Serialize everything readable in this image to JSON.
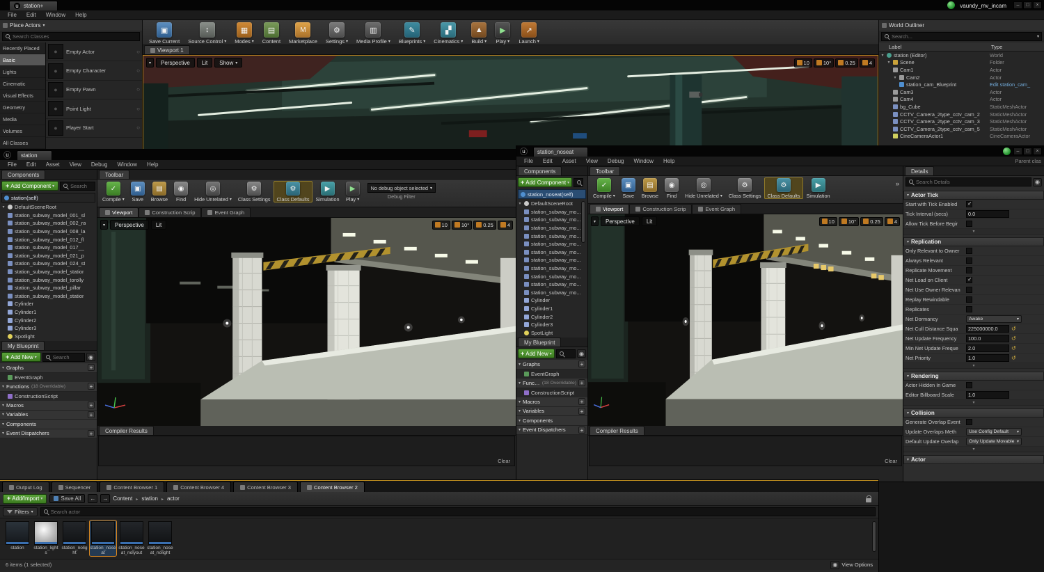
{
  "main": {
    "tab": "station+",
    "menus": [
      "File",
      "Edit",
      "Window",
      "Help"
    ],
    "session_label": "vaundy_mv_incam",
    "toolbar": [
      {
        "label": "Save Current",
        "icon": "save-icon"
      },
      {
        "label": "Source Control",
        "icon": "source-control-icon",
        "dropdown": "1"
      },
      {
        "label": "Modes",
        "icon": "modes-icon",
        "dropdown": "1"
      },
      {
        "label": "Content",
        "icon": "content-icon"
      },
      {
        "label": "Marketplace",
        "icon": "marketplace-icon"
      },
      {
        "label": "Settings",
        "icon": "settings-icon",
        "dropdown": "1"
      },
      {
        "label": "Media Profile",
        "icon": "media-profile-icon",
        "dropdown": "1"
      },
      {
        "label": "Blueprints",
        "icon": "blueprints-icon",
        "dropdown": "1"
      },
      {
        "label": "Cinematics",
        "icon": "cinematics-icon",
        "dropdown": "1"
      },
      {
        "label": "Build",
        "icon": "build-icon",
        "dropdown": "1"
      },
      {
        "label": "Play",
        "icon": "play-icon",
        "dropdown": "1"
      },
      {
        "label": "Launch",
        "icon": "launch-icon",
        "dropdown": "1"
      }
    ],
    "place_actors": {
      "title": "Place Actors",
      "search_placeholder": "Search Classes",
      "categories": [
        {
          "label": "Recently Placed"
        },
        {
          "label": "Basic",
          "state": "active"
        },
        {
          "label": "Lights"
        },
        {
          "label": "Cinematic"
        },
        {
          "label": "Visual Effects"
        },
        {
          "label": "Geometry"
        },
        {
          "label": "Media"
        },
        {
          "label": "Volumes"
        },
        {
          "label": "All Classes"
        }
      ],
      "items": [
        {
          "label": "Empty Actor"
        },
        {
          "label": "Empty Character"
        },
        {
          "label": "Empty Pawn"
        },
        {
          "label": "Point Light"
        },
        {
          "label": "Player Start"
        }
      ]
    },
    "viewport": {
      "tab": "Viewport 1",
      "persp": "Perspective",
      "lit": "Lit",
      "show": "Show",
      "stats": [
        "10",
        "10°",
        "0.25",
        "4"
      ]
    },
    "outliner": {
      "title": "World Outliner",
      "search_placeholder": "Search...",
      "col_label": "Label",
      "col_type": "Type",
      "rows": [
        {
          "label": "station (Editor)",
          "type": "World",
          "indent": 0,
          "icon": "world-icon",
          "arrow": "1"
        },
        {
          "label": "Scene",
          "type": "Folder",
          "indent": 1,
          "icon": "folder-icon",
          "arrow": "1"
        },
        {
          "label": "Cam1",
          "type": "Actor",
          "indent": 2,
          "icon": "camera-icon"
        },
        {
          "label": "Cam2",
          "type": "Actor",
          "indent": 2,
          "icon": "camera-icon",
          "arrow": "1"
        },
        {
          "label": "station_cam_Blueprint",
          "type": "Edit station_cam_",
          "indent": 3,
          "icon": "blueprint-icon",
          "type_style": "link"
        },
        {
          "label": "Cam3",
          "type": "Actor",
          "indent": 2,
          "icon": "camera-icon"
        },
        {
          "label": "Cam4",
          "type": "Actor",
          "indent": 2,
          "icon": "camera-icon"
        },
        {
          "label": "bg_Cube",
          "type": "StaticMeshActor",
          "indent": 2,
          "icon": "mesh-icon"
        },
        {
          "label": "CCTV_Camera_2type_cctv_cam_2",
          "type": "StaticMeshActor",
          "indent": 2,
          "icon": "mesh-icon"
        },
        {
          "label": "CCTV_Camera_2type_cctv_cam_3",
          "type": "StaticMeshActor",
          "indent": 2,
          "icon": "mesh-icon"
        },
        {
          "label": "CCTV_Camera_2type_cctv_cam_5",
          "type": "StaticMeshActor",
          "indent": 2,
          "icon": "mesh-icon"
        },
        {
          "label": "CineCameraActor1",
          "type": "CineCameraActor",
          "indent": 2,
          "icon": "cinecam-icon"
        }
      ]
    }
  },
  "bp1": {
    "tab": "station",
    "menus": [
      "File",
      "Edit",
      "Asset",
      "View",
      "Debug",
      "Window",
      "Help"
    ],
    "components": {
      "tab": "Components",
      "add_label": "Add Component",
      "search_placeholder": "Search",
      "selector": "station(self)",
      "tree": [
        {
          "label": "DefaultSceneRoot",
          "indent": 0,
          "icon": "scene-icon",
          "arrow": "1"
        },
        {
          "label": "station_subway_model_001_sl",
          "indent": 1,
          "icon": "mesh-icon"
        },
        {
          "label": "station_subway_model_002_ra",
          "indent": 1,
          "icon": "mesh-icon"
        },
        {
          "label": "station_subway_model_008_la",
          "indent": 1,
          "icon": "mesh-icon"
        },
        {
          "label": "station_subway_model_012_fl",
          "indent": 1,
          "icon": "mesh-icon"
        },
        {
          "label": "station_subway_model_017__",
          "indent": 1,
          "icon": "mesh-icon"
        },
        {
          "label": "station_subway_model_021_p",
          "indent": 1,
          "icon": "mesh-icon"
        },
        {
          "label": "station_subway_model_024_st",
          "indent": 1,
          "icon": "mesh-icon"
        },
        {
          "label": "station_subway_model_statior",
          "indent": 1,
          "icon": "mesh-icon"
        },
        {
          "label": "station_subway_model_torolly",
          "indent": 1,
          "icon": "mesh-icon"
        },
        {
          "label": "station_subway_model_pillar",
          "indent": 1,
          "icon": "mesh-icon"
        },
        {
          "label": "station_subway_model_statior",
          "indent": 1,
          "icon": "mesh-icon"
        },
        {
          "label": "Cylinder",
          "indent": 1,
          "icon": "cylinder-icon"
        },
        {
          "label": "Cylinder1",
          "indent": 1,
          "icon": "cylinder-icon"
        },
        {
          "label": "Cylinder2",
          "indent": 1,
          "icon": "cylinder-icon"
        },
        {
          "label": "Cylinder3",
          "indent": 1,
          "icon": "cylinder-icon"
        },
        {
          "label": "Spotlight",
          "indent": 1,
          "icon": "light-icon"
        }
      ]
    },
    "my_blueprint": {
      "tab": "My Blueprint",
      "add_label": "Add New",
      "search_placeholder": "Search",
      "rows": [
        {
          "label": "Graphs",
          "kind": "header",
          "plus": "1"
        },
        {
          "label": "EventGraph",
          "kind": "child",
          "icon": "graphtab-icon",
          "indent": 1
        },
        {
          "label": "Functions",
          "note": "(18 Overridable)",
          "kind": "header",
          "plus": "1"
        },
        {
          "label": "ConstructionScript",
          "kind": "child",
          "icon": "function-icon",
          "indent": 1
        },
        {
          "label": "Macros",
          "kind": "header",
          "plus": "1"
        },
        {
          "label": "Variables",
          "kind": "header",
          "plus": "1"
        },
        {
          "label": "Components",
          "kind": "header"
        },
        {
          "label": "Event Dispatchers",
          "kind": "header",
          "plus": "1"
        }
      ]
    },
    "toolbar_tab": "Toolbar",
    "toolbar": [
      {
        "label": "Compile",
        "icon": "compile-icon",
        "dropdown": "1"
      },
      {
        "label": "Save",
        "icon": "save-icon"
      },
      {
        "label": "Browse",
        "icon": "browse-icon"
      },
      {
        "label": "Find",
        "icon": "find-icon"
      },
      {
        "label": "Hide Unrelated",
        "icon": "hide-unrelated-icon",
        "dropdown": "1"
      },
      {
        "label": "Class Settings",
        "icon": "class-settings-icon"
      },
      {
        "label": "Class Defaults",
        "icon": "class-defaults-icon",
        "state": "selected"
      },
      {
        "label": "Simulation",
        "icon": "simulation-icon"
      },
      {
        "label": "Play",
        "icon": "play-icon",
        "dropdown": "1"
      }
    ],
    "debug_value": "No debug object selected",
    "debug_caption": "Debug Filter",
    "tabs": [
      {
        "label": "Viewport",
        "icon": "viewport-icon",
        "state": "active"
      },
      {
        "label": "Construction Scrip",
        "icon": "script-icon"
      },
      {
        "label": "Event Graph",
        "icon": "graphtab-icon"
      }
    ],
    "viewport": {
      "persp": "Perspective",
      "lit": "Lit",
      "stats": [
        "10",
        "10°",
        "0.25",
        "4"
      ]
    },
    "compiler": {
      "tab": "Compiler Results",
      "clear": "Clear"
    }
  },
  "bp2": {
    "tab": "station_noseat",
    "menus": [
      "File",
      "Edit",
      "Asset",
      "View",
      "Debug",
      "Window",
      "Help"
    ],
    "parent_label": "Parent clas",
    "components": {
      "tab": "Components",
      "add_label": "Add Component",
      "search_placeholder": "Search",
      "selector": "station_noseat(self)",
      "tree": [
        {
          "label": "DefaultSceneRoot",
          "indent": 0,
          "icon": "scene-icon",
          "arrow": "1"
        },
        {
          "label": "station_subway_mo...",
          "indent": 1,
          "icon": "mesh-icon"
        },
        {
          "label": "station_subway_mo...",
          "indent": 1,
          "icon": "mesh-icon"
        },
        {
          "label": "station_subway_mo...",
          "indent": 1,
          "icon": "mesh-icon"
        },
        {
          "label": "station_subway_mo...",
          "indent": 1,
          "icon": "mesh-icon"
        },
        {
          "label": "station_subway_mo...",
          "indent": 1,
          "icon": "mesh-icon"
        },
        {
          "label": "station_subway_mo...",
          "indent": 1,
          "icon": "mesh-icon"
        },
        {
          "label": "station_subway_mo...",
          "indent": 1,
          "icon": "mesh-icon"
        },
        {
          "label": "station_subway_mo...",
          "indent": 1,
          "icon": "mesh-icon"
        },
        {
          "label": "station_subway_mo...",
          "indent": 1,
          "icon": "mesh-icon"
        },
        {
          "label": "station_subway_mo...",
          "indent": 1,
          "icon": "mesh-icon"
        },
        {
          "label": "station_subway_mo...",
          "indent": 1,
          "icon": "mesh-icon"
        },
        {
          "label": "Cylinder",
          "indent": 1,
          "icon": "cylinder-icon"
        },
        {
          "label": "Cylinder1",
          "indent": 1,
          "icon": "cylinder-icon"
        },
        {
          "label": "Cylinder2",
          "indent": 1,
          "icon": "cylinder-icon"
        },
        {
          "label": "Cylinder3",
          "indent": 1,
          "icon": "cylinder-icon"
        },
        {
          "label": "SpotLight",
          "indent": 1,
          "icon": "light-icon"
        }
      ]
    },
    "my_blueprint": {
      "tab": "My Blueprint",
      "add_label": "Add New",
      "search_placeholder": "Search",
      "rows": [
        {
          "label": "Graphs",
          "kind": "header",
          "plus": "1"
        },
        {
          "label": "EventGraph",
          "kind": "child",
          "icon": "graphtab-icon",
          "indent": 1
        },
        {
          "label": "Functions",
          "note": "(18 Overridable)",
          "kind": "header",
          "plus": "1"
        },
        {
          "label": "ConstructionScript",
          "kind": "child",
          "icon": "function-icon",
          "indent": 1
        },
        {
          "label": "Macros",
          "kind": "header",
          "plus": "1"
        },
        {
          "label": "Variables",
          "kind": "header",
          "plus": "1"
        },
        {
          "label": "Components",
          "kind": "header"
        },
        {
          "label": "Event Dispatchers",
          "kind": "header",
          "plus": "1"
        }
      ]
    },
    "toolbar_tab": "Toolbar",
    "toolbar": [
      {
        "label": "Compile",
        "icon": "compile-icon",
        "dropdown": "1"
      },
      {
        "label": "Save",
        "icon": "save-icon"
      },
      {
        "label": "Browse",
        "icon": "browse-icon"
      },
      {
        "label": "Find",
        "icon": "find-icon"
      },
      {
        "label": "Hide Unrelated",
        "icon": "hide-unrelated-icon",
        "dropdown": "1"
      },
      {
        "label": "Class Settings",
        "icon": "class-settings-icon"
      },
      {
        "label": "Class Defaults",
        "icon": "class-defaults-icon",
        "state": "selected"
      },
      {
        "label": "Simulation",
        "icon": "simulation-icon"
      }
    ],
    "tabs": [
      {
        "label": "Viewport",
        "icon": "viewport-icon",
        "state": "active"
      },
      {
        "label": "Construction Scrip",
        "icon": "script-icon"
      },
      {
        "label": "Event Graph",
        "icon": "graphtab-icon"
      }
    ],
    "viewport": {
      "persp": "Perspective",
      "lit": "Lit",
      "stats": [
        "10",
        "10°",
        "0.25",
        "4"
      ]
    },
    "compiler": {
      "tab": "Compiler Results",
      "clear": "Clear"
    }
  },
  "details": {
    "tab": "Details",
    "search_placeholder": "Search Details",
    "rows": [
      {
        "title": "Actor Tick"
      },
      {
        "label": "Start with Tick Enabled",
        "control": "checkbox",
        "state": "checked"
      },
      {
        "label": "Tick Interval (secs)",
        "control": "value",
        "value": "0.0"
      },
      {
        "label": "Allow Tick Before Begir",
        "control": "checkbox"
      },
      {
        "advanced": "1"
      },
      {
        "title": "Replication"
      },
      {
        "label": "Only Relevant to Owner",
        "control": "checkbox"
      },
      {
        "label": "Always Relevant",
        "control": "checkbox"
      },
      {
        "label": "Replicate Movement",
        "control": "checkbox"
      },
      {
        "label": "Net Load on Client",
        "control": "checkbox",
        "state": "checked"
      },
      {
        "label": "Net Use Owner Relevan",
        "control": "checkbox"
      },
      {
        "label": "Replay Rewindable",
        "control": "checkbox"
      },
      {
        "label": "Replicates",
        "control": "checkbox"
      },
      {
        "label": "Net Dormancy",
        "control": "dropdown",
        "value": "Awake"
      },
      {
        "label": "Net Cull Distance Squa",
        "control": "value",
        "value": "225000000.0",
        "reset": "show"
      },
      {
        "label": "Net Update Frequency",
        "control": "value",
        "value": "100.0",
        "reset": "show"
      },
      {
        "label": "Min Net Update Freque",
        "control": "value",
        "value": "2.0",
        "reset": "show"
      },
      {
        "label": "Net Priority",
        "control": "value",
        "value": "1.0",
        "reset": "show"
      },
      {
        "advanced": "1"
      },
      {
        "title": "Rendering"
      },
      {
        "label": "Actor Hidden In Game",
        "control": "checkbox"
      },
      {
        "label": "Editor Billboard Scale",
        "control": "value",
        "value": "1.0"
      },
      {
        "advanced": "1"
      },
      {
        "title": "Collision"
      },
      {
        "label": "Generate Overlap Event",
        "control": "checkbox"
      },
      {
        "label": "Update Overlaps Meth",
        "control": "dropdown",
        "value": "Use Config Default"
      },
      {
        "label": "Default Update Overlap",
        "control": "dropdown",
        "value": "Only Update Movable"
      },
      {
        "advanced": "1"
      },
      {
        "title": "Actor"
      }
    ]
  },
  "cb": {
    "dock_tabs": [
      {
        "label": "Output Log",
        "icon": "log-icon"
      },
      {
        "label": "Sequencer",
        "icon": "sequencer-icon"
      },
      {
        "label": "Content Browser 1",
        "icon": "browser-icon"
      },
      {
        "label": "Content Browser 4",
        "icon": "browser-icon"
      },
      {
        "label": "Content Browser 3",
        "icon": "browser-icon"
      },
      {
        "label": "Content Browser 2",
        "icon": "browser-icon",
        "state": "active"
      }
    ],
    "add_import_label": "Add/Import",
    "save_all_label": "Save All",
    "breadcrumb": [
      "Content",
      "station",
      "actor"
    ],
    "filters_label": "Filters",
    "search_placeholder": "Search actor",
    "assets": [
      {
        "label": "station",
        "thumb": "thumb-bp"
      },
      {
        "label": "station_lights",
        "thumb": "thumb-sphere"
      },
      {
        "label": "station_nolight",
        "thumb": "thumb-dark"
      },
      {
        "label": "station_noseat",
        "thumb": "thumb-dark",
        "state": "selected"
      },
      {
        "label": "station_noseat_nolyout",
        "thumb": "thumb-dark"
      },
      {
        "label": "station_noseat_nolight",
        "thumb": "thumb-dark"
      }
    ],
    "status": "6 items (1 selected)",
    "view_options_label": "View Options"
  }
}
